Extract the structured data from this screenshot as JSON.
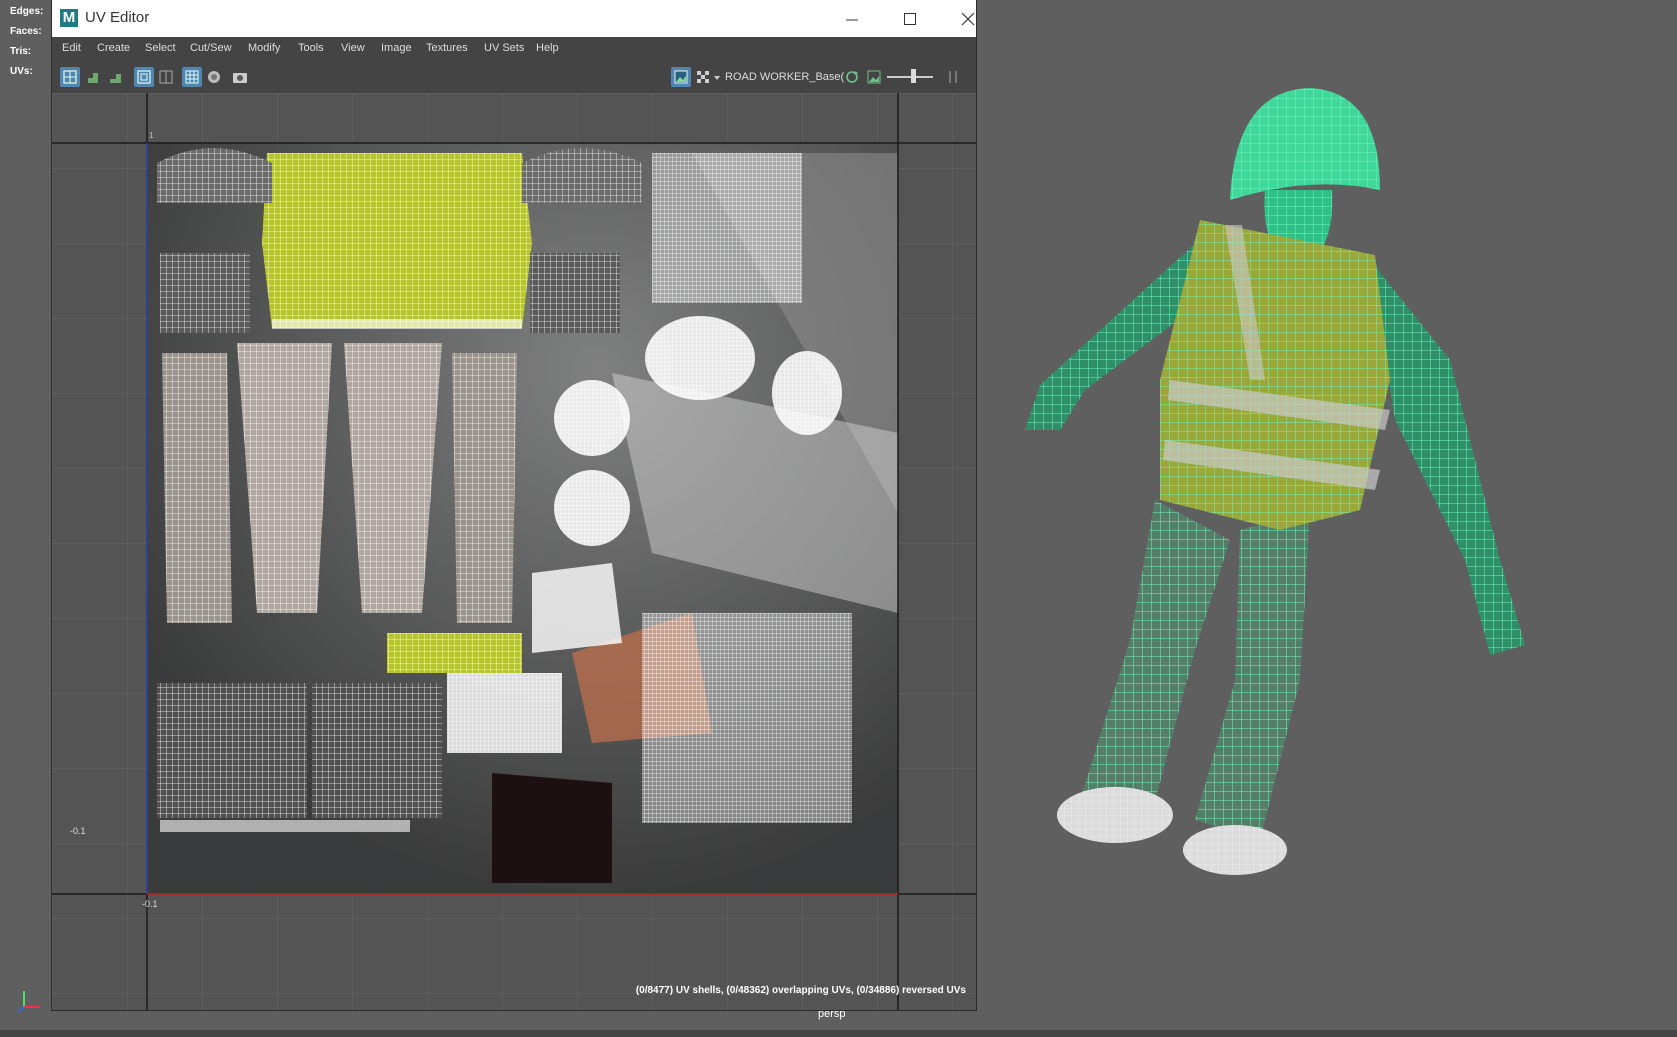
{
  "hud": {
    "edges": "Edges:",
    "faces": "Faces:",
    "tris": "Tris:",
    "uvs": "UVs:"
  },
  "viewport": {
    "camera_label": "persp"
  },
  "window": {
    "title": "UV Editor",
    "app_icon": "M"
  },
  "menu": [
    "Edit",
    "Create",
    "Select",
    "Cut/Sew",
    "Modify",
    "Tools",
    "View",
    "Image",
    "Textures",
    "UV Sets",
    "Help"
  ],
  "toolbar": {
    "texture_name": "ROAD WORKER_Base("
  },
  "uv": {
    "tick_top": "1",
    "tick_left": "-0.1",
    "tick_bottom": "-0.1",
    "status": "(0/8477) UV shells, (0/48362) overlapping UVs, (0/34886) reversed UVs"
  },
  "colors": {
    "accent": "#5186b0",
    "wire": "#5ff2b0",
    "vest": "#b6c42e"
  }
}
